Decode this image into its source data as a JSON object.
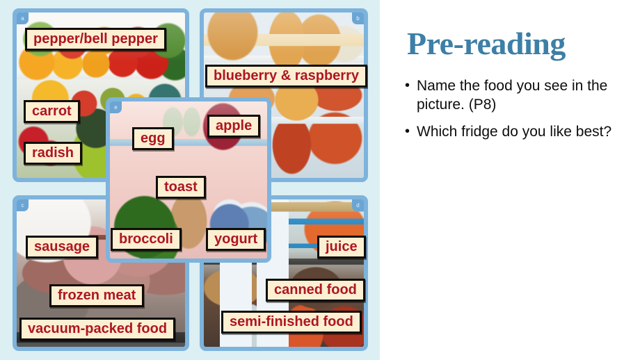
{
  "slide": {
    "background_color": "#ffffff",
    "left_panel_color": "#dceff3",
    "panel_border_color": "#7db3dc",
    "label_bg_color": "#fcefd2",
    "label_text_color": "#ad1622",
    "label_border_color": "#100d08",
    "title_color": "#3d7fa6",
    "body_text_color": "#0d0d0d"
  },
  "photos": [
    {
      "key": "a",
      "marker": "a",
      "marker_position": "top-left",
      "caption": "fridge with peppers, carrots and radishes"
    },
    {
      "key": "b",
      "marker": "b",
      "marker_position": "top-right",
      "caption": "fridge with breads, pies and frozen packs"
    },
    {
      "key": "c",
      "marker": "c",
      "marker_position": "top-left",
      "caption": "freezer with raw and vacuum packed meat"
    },
    {
      "key": "d",
      "marker": "d",
      "marker_position": "top-right",
      "caption": "fridge with juice cartons and canned food"
    },
    {
      "key": "e",
      "marker": "e",
      "marker_position": "top-left",
      "caption": "fridge with eggs, apple, toast, broccoli and yogurt"
    }
  ],
  "labels": {
    "pepper": "pepper/bell pepper",
    "carrot": "carrot",
    "radish": "radish",
    "blueberry": "blueberry & raspberry",
    "egg": "egg",
    "apple": "apple",
    "toast": "toast",
    "broccoli": "broccoli",
    "yogurt": "yogurt",
    "sausage": "sausage",
    "frozen_meat": "frozen meat",
    "vacuum": "vacuum-packed food",
    "juice": "juice",
    "canned": "canned food",
    "semi": "semi-finished food"
  },
  "right": {
    "title": "Pre-reading",
    "bullet_glyph": "•",
    "bullets": [
      "Name the food you see in the picture. (P8)",
      "Which fridge do you like best?"
    ]
  }
}
